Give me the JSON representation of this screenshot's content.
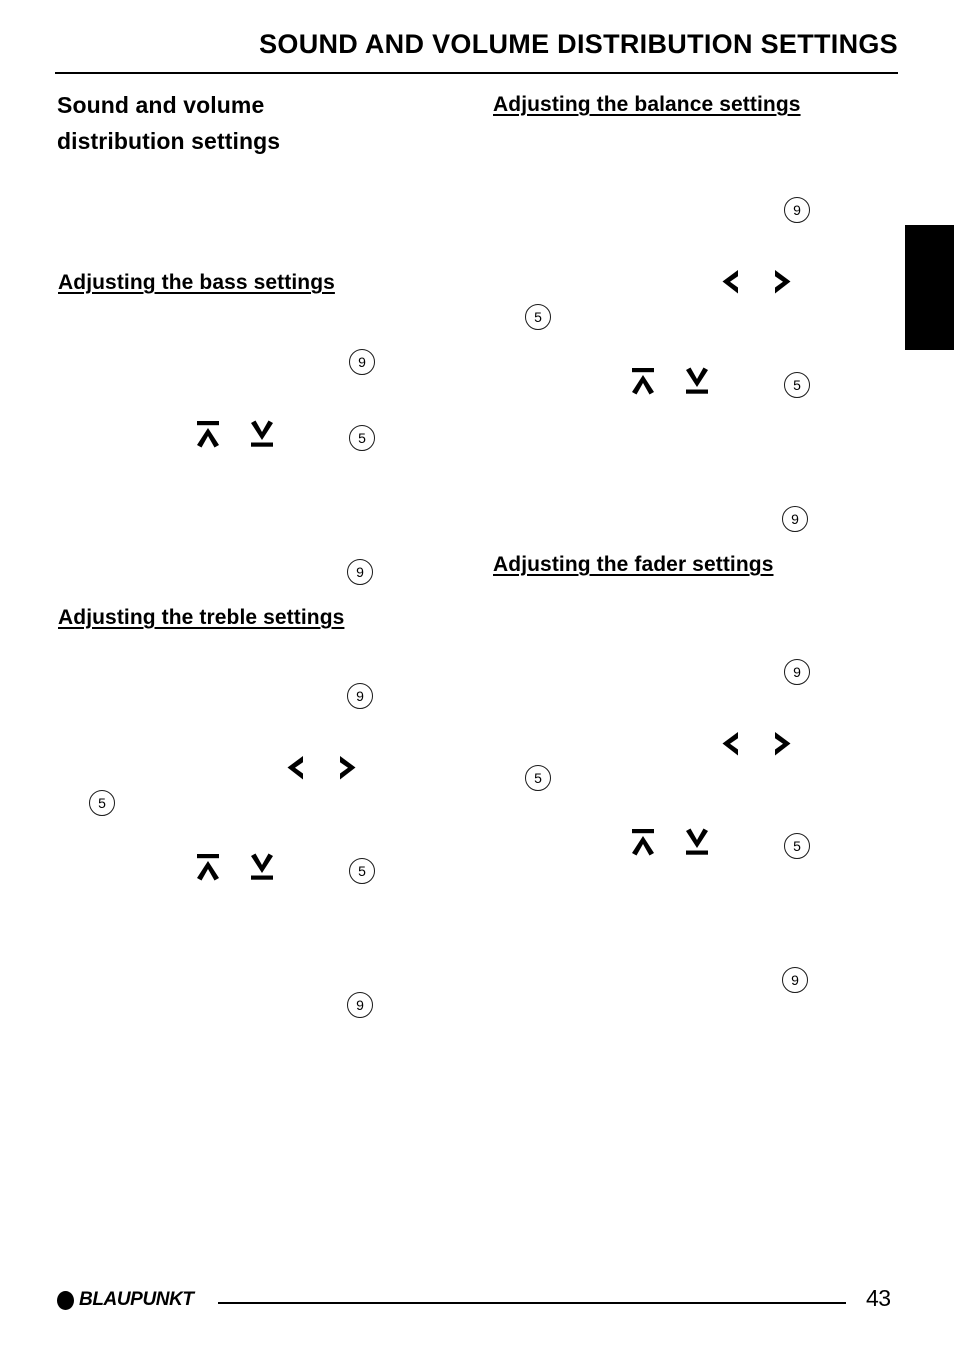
{
  "header": {
    "title": "SOUND AND VOLUME DISTRIBUTION SETTINGS"
  },
  "left_column": {
    "main_heading": "Sound and volume distribution settings",
    "sections": [
      {
        "heading": "Adjusting the bass settings",
        "badges": [
          "9",
          "5",
          "9"
        ],
        "glyphs": [
          "arrow-up-bar",
          "arrow-down-bar"
        ]
      },
      {
        "heading": "Adjusting the treble settings",
        "badges": [
          "9",
          "5",
          "5",
          "9"
        ],
        "glyphs": [
          "chevron-left",
          "chevron-right",
          "arrow-up-bar",
          "arrow-down-bar"
        ]
      }
    ]
  },
  "right_column": {
    "sections": [
      {
        "heading": "Adjusting the balance settings",
        "badges": [
          "9",
          "5",
          "5",
          "9"
        ],
        "glyphs": [
          "chevron-left",
          "chevron-right",
          "arrow-up-bar",
          "arrow-down-bar"
        ]
      },
      {
        "heading": "Adjusting the fader settings",
        "badges": [
          "9",
          "5",
          "5",
          "9"
        ],
        "glyphs": [
          "chevron-left",
          "chevron-right",
          "arrow-up-bar",
          "arrow-down-bar"
        ]
      }
    ]
  },
  "badges": {
    "nine": "9",
    "five": "5"
  },
  "footer": {
    "brand": "BLAUPUNKT",
    "page_number": "43"
  },
  "colors": {
    "ink": "#000000",
    "paper": "#ffffff"
  }
}
